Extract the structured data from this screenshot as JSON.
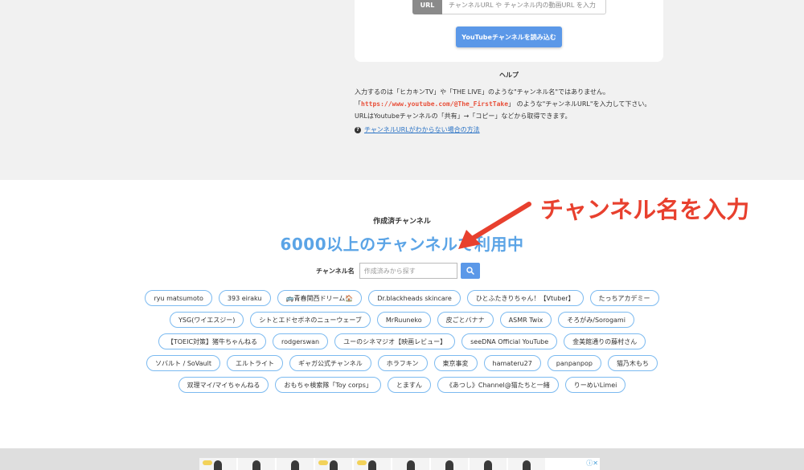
{
  "top_form": {
    "url_label": "URL",
    "url_placeholder": "チャンネルURL や チャンネル内の動画URL を入力",
    "load_button": "YouTubeチャンネルを読み込む"
  },
  "help": {
    "title": "ヘルプ",
    "line1": "入力するのは「ヒカキンTV」や「THE LIVE」のような\"チャンネル名\"ではありません。",
    "line2_open": "「",
    "line2_url": "https://www.youtube.com/@The_FirstTake",
    "line2_rest": "」 のような\"チャンネルURL\"を入力して下さい。",
    "line3": "URLはYoutubeチャンネルの「共有」→「コピー」などから取得できます。",
    "link_icon": "question-circle-icon",
    "link_text": "チャンネルURLがわからない場合の方法"
  },
  "channels": {
    "section_title": "作成済チャンネル",
    "heading": "6000以上のチャンネルで利用中",
    "search_label": "チャンネル名",
    "search_placeholder": "作成済みから探す",
    "search_icon": "search-icon",
    "tags": [
      "ryu matsumoto",
      "393 eiraku",
      "🚌青春関西ドリーム🏠",
      "Dr.blackheads skincare",
      "ひとふたきりちゃん！【Vtuber】",
      "たっちアカデミー",
      "YSG(ワイエスジー)",
      "シトとエドセボネのニューウェーブ",
      "MrRuuneko",
      "皮ごとバナナ",
      "ASMR Twix",
      "そろがみ/Sorogami",
      "【TOEIC対策】猪牛ちゃんねる",
      "rodgerswan",
      "ユーのシネマジオ【映画レビュー】",
      "seeDNA Official YouTube",
      "金美館通りの藤村さん",
      "ソバルト / SoVault",
      "エルトライト",
      "ギャガ公式チャンネル",
      "ホラフキン",
      "東京事変",
      "hamateru27",
      "panpanpop",
      "猫乃木もち",
      "双理マイ/マイちゃんねる",
      "おもちゃ検索隊「Toy corps」",
      "とますん",
      "《あつし》Channel@猫たちと一緒",
      "りーめいLimei"
    ]
  },
  "annotation": {
    "text": "チャンネル名を入力",
    "color": "#e8402e"
  },
  "ad": {
    "choice_icon": "ad-choices-icon",
    "choice_text": "ⓘ✕"
  },
  "colors": {
    "accent": "#5b98e8",
    "heading": "#5ba4e6",
    "tag_border": "#7cbaf0",
    "link": "#2b73c5",
    "help_url": "#e8503a"
  }
}
